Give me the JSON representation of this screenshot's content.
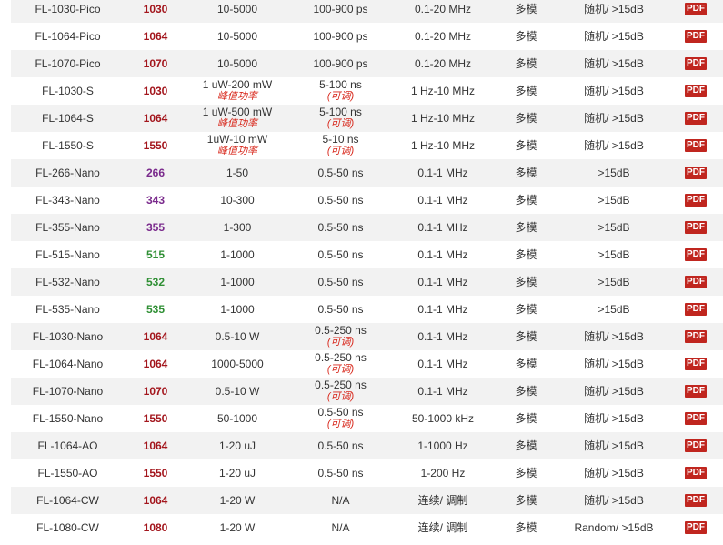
{
  "pdf_label": "PDF",
  "rows": [
    {
      "model": "FL-1030-Pico",
      "wavelength": "1030",
      "wavelength_color": "#a3161d",
      "power": "10-5000",
      "power_note": "",
      "pulse": "100-900 ps",
      "pulse_note": "",
      "rep_rate": "0.1-20 MHz",
      "mode": "多模",
      "polarization": "随机/ >15dB"
    },
    {
      "model": "FL-1064-Pico",
      "wavelength": "1064",
      "wavelength_color": "#a3161d",
      "power": "10-5000",
      "power_note": "",
      "pulse": "100-900 ps",
      "pulse_note": "",
      "rep_rate": "0.1-20 MHz",
      "mode": "多模",
      "polarization": "随机/ >15dB"
    },
    {
      "model": "FL-1070-Pico",
      "wavelength": "1070",
      "wavelength_color": "#a3161d",
      "power": "10-5000",
      "power_note": "",
      "pulse": "100-900 ps",
      "pulse_note": "",
      "rep_rate": "0.1-20 MHz",
      "mode": "多模",
      "polarization": "随机/ >15dB"
    },
    {
      "model": "FL-1030-S",
      "wavelength": "1030",
      "wavelength_color": "#a3161d",
      "power": "1 uW-200 mW",
      "power_note": "峰值功率",
      "pulse": "5-100 ns",
      "pulse_note": "(可调)",
      "rep_rate": "1 Hz-10 MHz",
      "mode": "多模",
      "polarization": "随机/ >15dB"
    },
    {
      "model": "FL-1064-S",
      "wavelength": "1064",
      "wavelength_color": "#a3161d",
      "power": "1 uW-500 mW",
      "power_note": "峰值功率",
      "pulse": "5-100 ns",
      "pulse_note": "(可调)",
      "rep_rate": "1 Hz-10 MHz",
      "mode": "多模",
      "polarization": "随机/ >15dB"
    },
    {
      "model": "FL-1550-S",
      "wavelength": "1550",
      "wavelength_color": "#a3161d",
      "power": "1uW-10 mW",
      "power_note": "峰值功率",
      "pulse": "5-10 ns",
      "pulse_note": "(可调)",
      "rep_rate": "1 Hz-10 MHz",
      "mode": "多模",
      "polarization": "随机/ >15dB"
    },
    {
      "model": "FL-266-Nano",
      "wavelength": "266",
      "wavelength_color": "#7a2a8c",
      "power": "1-50",
      "power_note": "",
      "pulse": "0.5-50 ns",
      "pulse_note": "",
      "rep_rate": "0.1-1 MHz",
      "mode": "多模",
      "polarization": ">15dB"
    },
    {
      "model": "FL-343-Nano",
      "wavelength": "343",
      "wavelength_color": "#7a2a8c",
      "power": "10-300",
      "power_note": "",
      "pulse": "0.5-50 ns",
      "pulse_note": "",
      "rep_rate": "0.1-1 MHz",
      "mode": "多模",
      "polarization": ">15dB"
    },
    {
      "model": "FL-355-Nano",
      "wavelength": "355",
      "wavelength_color": "#7a2a8c",
      "power": "1-300",
      "power_note": "",
      "pulse": "0.5-50 ns",
      "pulse_note": "",
      "rep_rate": "0.1-1 MHz",
      "mode": "多模",
      "polarization": ">15dB"
    },
    {
      "model": "FL-515-Nano",
      "wavelength": "515",
      "wavelength_color": "#2f8f34",
      "power": "1-1000",
      "power_note": "",
      "pulse": "0.5-50 ns",
      "pulse_note": "",
      "rep_rate": "0.1-1 MHz",
      "mode": "多模",
      "polarization": ">15dB"
    },
    {
      "model": "FL-532-Nano",
      "wavelength": "532",
      "wavelength_color": "#2f8f34",
      "power": "1-1000",
      "power_note": "",
      "pulse": "0.5-50 ns",
      "pulse_note": "",
      "rep_rate": "0.1-1 MHz",
      "mode": "多模",
      "polarization": ">15dB"
    },
    {
      "model": "FL-535-Nano",
      "wavelength": "535",
      "wavelength_color": "#2f8f34",
      "power": "1-1000",
      "power_note": "",
      "pulse": "0.5-50 ns",
      "pulse_note": "",
      "rep_rate": "0.1-1 MHz",
      "mode": "多模",
      "polarization": ">15dB"
    },
    {
      "model": "FL-1030-Nano",
      "wavelength": "1064",
      "wavelength_color": "#a3161d",
      "power": "0.5-10 W",
      "power_note": "",
      "pulse": "0.5-250 ns",
      "pulse_note": "(可调)",
      "rep_rate": "0.1-1 MHz",
      "mode": "多模",
      "polarization": "随机/ >15dB"
    },
    {
      "model": "FL-1064-Nano",
      "wavelength": "1064",
      "wavelength_color": "#a3161d",
      "power": "1000-5000",
      "power_note": "",
      "pulse": "0.5-250 ns",
      "pulse_note": "(可调)",
      "rep_rate": "0.1-1 MHz",
      "mode": "多模",
      "polarization": "随机/ >15dB"
    },
    {
      "model": "FL-1070-Nano",
      "wavelength": "1070",
      "wavelength_color": "#a3161d",
      "power": "0.5-10 W",
      "power_note": "",
      "pulse": "0.5-250 ns",
      "pulse_note": "(可调)",
      "rep_rate": "0.1-1 MHz",
      "mode": "多模",
      "polarization": "随机/ >15dB"
    },
    {
      "model": "FL-1550-Nano",
      "wavelength": "1550",
      "wavelength_color": "#a3161d",
      "power": "50-1000",
      "power_note": "",
      "pulse": "0.5-50 ns",
      "pulse_note": "(可调)",
      "rep_rate": "50-1000 kHz",
      "mode": "多模",
      "polarization": "随机/ >15dB"
    },
    {
      "model": "FL-1064-AO",
      "wavelength": "1064",
      "wavelength_color": "#a3161d",
      "power": "1-20 uJ",
      "power_note": "",
      "pulse": "0.5-50 ns",
      "pulse_note": "",
      "rep_rate": "1-1000 Hz",
      "mode": "多模",
      "polarization": "随机/ >15dB"
    },
    {
      "model": "FL-1550-AO",
      "wavelength": "1550",
      "wavelength_color": "#a3161d",
      "power": "1-20 uJ",
      "power_note": "",
      "pulse": "0.5-50 ns",
      "pulse_note": "",
      "rep_rate": "1-200 Hz",
      "mode": "多模",
      "polarization": "随机/ >15dB"
    },
    {
      "model": "FL-1064-CW",
      "wavelength": "1064",
      "wavelength_color": "#a3161d",
      "power": "1-20 W",
      "power_note": "",
      "pulse": "N/A",
      "pulse_note": "",
      "rep_rate": "连续/ 调制",
      "mode": "多模",
      "polarization": "随机/ >15dB"
    },
    {
      "model": "FL-1080-CW",
      "wavelength": "1080",
      "wavelength_color": "#a3161d",
      "power": "1-20 W",
      "power_note": "",
      "pulse": "N/A",
      "pulse_note": "",
      "rep_rate": "连续/ 调制",
      "mode": "多模",
      "polarization": "Random/ >15dB"
    }
  ]
}
